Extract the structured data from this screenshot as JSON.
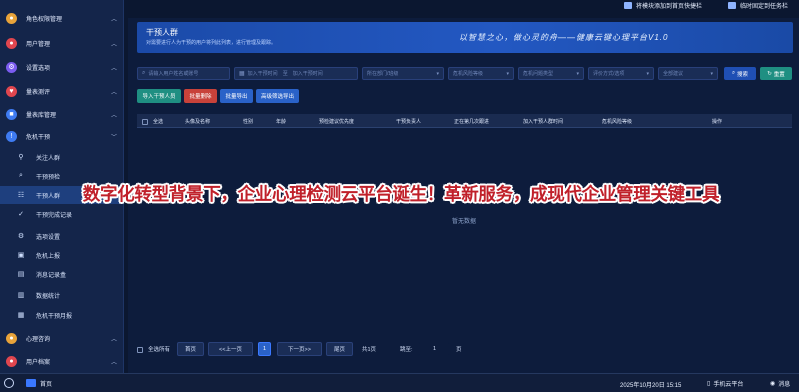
{
  "top_actions": {
    "add_shortcut": "将模块添加到首页快捷栏",
    "pin_task": "临时固定到任务栏"
  },
  "sidebar": {
    "items": [
      {
        "label": "角色权限管理",
        "icon": "user-shield-icon",
        "color": "#e8a33a"
      },
      {
        "label": "用户管理",
        "icon": "users-icon",
        "color": "#e0464f"
      },
      {
        "label": "设置选项",
        "icon": "gear-icon",
        "color": "#7b5cf0"
      },
      {
        "label": "量表测评",
        "icon": "heart-icon",
        "color": "#e0464f"
      },
      {
        "label": "量表库管理",
        "icon": "database-icon",
        "color": "#3e7bf2"
      },
      {
        "label": "危机干预",
        "icon": "alert-icon",
        "color": "#3e7bf2"
      }
    ],
    "subitems": [
      {
        "label": "关注人群",
        "icon": "pin-icon"
      },
      {
        "label": "干预预检",
        "icon": "search-icon"
      },
      {
        "label": "干预人群",
        "icon": "group-icon"
      },
      {
        "label": "干预完成记录",
        "icon": "check-icon"
      },
      {
        "label": "选项设置",
        "icon": "gear-icon"
      },
      {
        "label": "危机上报",
        "icon": "upload-icon"
      },
      {
        "label": "消息记录盒",
        "icon": "inbox-icon"
      },
      {
        "label": "数据统计",
        "icon": "chart-icon"
      },
      {
        "label": "危机干预月报",
        "icon": "report-icon"
      }
    ],
    "bottom_items": [
      {
        "label": "心理咨询",
        "icon": "chat-icon",
        "color": "#e8a33a"
      },
      {
        "label": "用户档案",
        "icon": "folder-icon",
        "color": "#e0464f"
      }
    ]
  },
  "banner": {
    "title": "干预人群",
    "subtitle": "对需要进行人为干预的用户将列此列表，进行管理及跟踪。",
    "slogan": "以智慧之心，做心灵的舟——健康云键心理平台V1.0"
  },
  "filters": {
    "name": "请输入用户姓名或账号",
    "time_start": "加入干预时间",
    "time_sep": "至",
    "time_end": "加入干预时间",
    "dept": "所在部门/班级",
    "risk": "危机风险等级",
    "type": "危机问题类型",
    "method": "评价方式/选项",
    "suggest": "全部建议"
  },
  "buttons": {
    "search": "搜索",
    "reset": "重置",
    "add": "导入干预人员",
    "batch_delete": "批量删除",
    "batch_export": "批量导出",
    "advanced": "高级筛选导出"
  },
  "colors": {
    "add": "#1f8f82",
    "batch_delete": "#c8423a",
    "batch_export": "#2a62c8",
    "advanced": "#2a62c8"
  },
  "table": {
    "select_all": "全选",
    "columns": [
      "头像及名称",
      "性别",
      "年龄",
      "预检建议优先度",
      "干预负责人",
      "正在第几次跟进",
      "加入干预人群时间",
      "危机风险等级",
      "操作"
    ],
    "empty": "暂无数据"
  },
  "caption": "数字化转型背景下，企业心理检测云平台诞生！革新服务，成现代企业管理关键工具",
  "pagination": {
    "select_all": "全选所有",
    "first": "首页",
    "prev": "<<上一页",
    "current": "1",
    "next": "下一页>>",
    "last": "尾页",
    "total": "共1页",
    "jump": "跳至:",
    "jump_value": "1",
    "page_suffix": "页"
  },
  "taskbar": {
    "home": "首页",
    "datetime": "2025年10月20日 15:15",
    "mobile": "手机云平台",
    "messages": "消息"
  }
}
